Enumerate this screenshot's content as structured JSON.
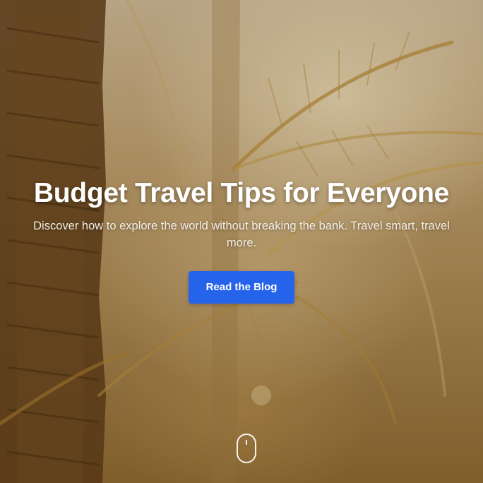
{
  "hero": {
    "title": "Budget Travel Tips for Everyone",
    "subtitle": "Discover how to explore the world without breaking the bank. Travel smart, travel more.",
    "cta_label": "Read the Blog",
    "background": "palm-trees-hazy-photo",
    "scroll_icon": "mouse-scroll-icon"
  },
  "colors": {
    "accent": "#2563eb",
    "text": "#ffffff"
  }
}
